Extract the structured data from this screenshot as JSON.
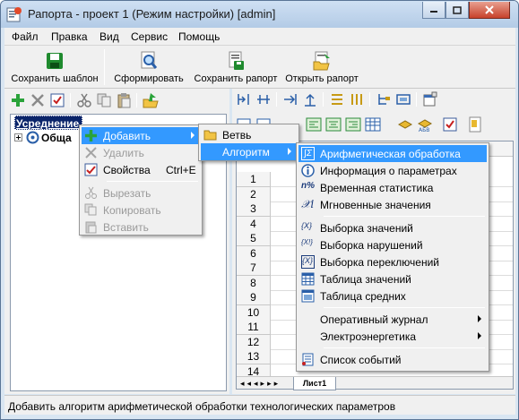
{
  "window": {
    "title": "Рапорта - проект 1 (Режим настройки) [admin]"
  },
  "menubar": {
    "items": [
      "Файл",
      "Правка",
      "Вид",
      "Сервис",
      "Помощь"
    ]
  },
  "toolbar": {
    "buttons": [
      {
        "label": "Сохранить шаблон",
        "icon": "save-icon"
      },
      {
        "label": "Сформировать",
        "icon": "magnifier-icon"
      },
      {
        "label": "Сохранить рапорт",
        "icon": "save-report-icon"
      },
      {
        "label": "Открыть рапорт",
        "icon": "open-report-icon"
      }
    ]
  },
  "tree": {
    "root_label": "Усреднение",
    "child_label": "Обща"
  },
  "grid": {
    "row_numbers": [
      "1",
      "2",
      "3",
      "4",
      "5",
      "6",
      "7",
      "8",
      "9",
      "10",
      "11",
      "12",
      "13",
      "14"
    ],
    "sheet_tab": "Лист1"
  },
  "context_menu": {
    "items": [
      {
        "label": "Добавить",
        "state": "highlighted",
        "icon": "plus-icon"
      },
      {
        "label": "Удалить",
        "state": "disabled",
        "icon": "delete-icon"
      },
      {
        "label": "Свойства",
        "shortcut": "Ctrl+E",
        "icon": "properties-icon"
      },
      {
        "label": "Вырезать",
        "state": "disabled",
        "icon": "cut-icon"
      },
      {
        "label": "Копировать",
        "state": "disabled",
        "icon": "copy-icon"
      },
      {
        "label": "Вставить",
        "state": "disabled",
        "icon": "paste-icon"
      }
    ]
  },
  "submenu_add": {
    "items": [
      {
        "label": "Ветвь",
        "icon": "folder-icon"
      },
      {
        "label": "Алгоритм",
        "state": "highlighted"
      }
    ]
  },
  "submenu_algorithm": {
    "items": [
      {
        "label": "Арифметическая обработка",
        "state": "highlighted",
        "glyph": "∫Σ"
      },
      {
        "label": "Информация о параметрах",
        "glyph": "i"
      },
      {
        "label": "Временная статистика",
        "glyph": "n%"
      },
      {
        "label": "Мгновенные значения",
        "glyph": "𝒳i"
      },
      {
        "label": "Выборка значений",
        "glyph": "{X}"
      },
      {
        "label": "Выборка нарушений",
        "glyph": "{X!}"
      },
      {
        "label": "Выборка переключений",
        "glyph": "{X}"
      },
      {
        "label": "Таблица значений",
        "glyph": "tbl"
      },
      {
        "label": "Таблица средних",
        "glyph": "tbl2"
      },
      {
        "label": "Оперативный журнал"
      },
      {
        "label": "Электроэнергетика"
      },
      {
        "label": "Список событий",
        "glyph": "list"
      }
    ]
  },
  "status": {
    "text": "Добавить алгоритм арифметической обработки технологических параметров"
  }
}
